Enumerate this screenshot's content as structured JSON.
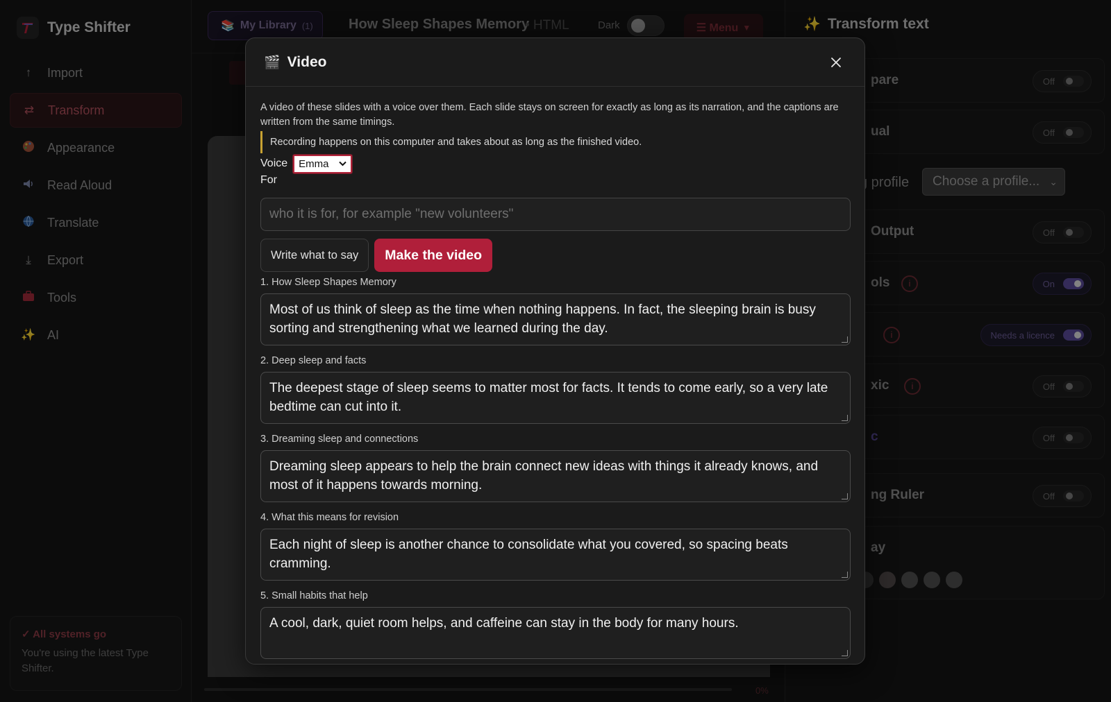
{
  "app": {
    "name": "Type Shifter"
  },
  "sidebar": {
    "items": [
      {
        "label": "Import",
        "icon": "arrow-up-icon"
      },
      {
        "label": "Transform",
        "icon": "swap-icon"
      },
      {
        "label": "Appearance",
        "icon": "palette-icon"
      },
      {
        "label": "Read Aloud",
        "icon": "speaker-icon"
      },
      {
        "label": "Translate",
        "icon": "globe-icon"
      },
      {
        "label": "Export",
        "icon": "download-icon"
      },
      {
        "label": "Tools",
        "icon": "toolbox-icon"
      },
      {
        "label": "AI",
        "icon": "sparkle-icon"
      }
    ],
    "active": "Transform",
    "status": {
      "title": "✓ All systems go",
      "text": "You're using the latest Type Shifter."
    }
  },
  "topbar": {
    "library_label": "My Library",
    "library_count": "(1)",
    "doc_title": "How Sleep Shapes Memory",
    "doc_format": "• HTML",
    "dark_label": "Dark",
    "menu_label": "☰ Menu"
  },
  "center": {
    "progress_text": "0%"
  },
  "right_panel": {
    "title": "Transform text",
    "rows": [
      {
        "label": "pare",
        "toggle": "Off"
      },
      {
        "label": "ual",
        "toggle": "Off"
      },
      {
        "label": "Output",
        "toggle": "Off"
      },
      {
        "label": "ols",
        "toggle": "On"
      },
      {
        "label": "",
        "toggle": "Needs a licence"
      },
      {
        "label": "xic",
        "toggle": "Off"
      },
      {
        "label": "c",
        "toggle": "Off"
      },
      {
        "label": "ng Ruler",
        "toggle": "Off"
      },
      {
        "label": "ay",
        "toggle": ""
      }
    ],
    "profile_label": "g profile",
    "profile_select": "Choose a profile..."
  },
  "modal": {
    "title": "Video",
    "description": "A video of these slides with a voice over them. Each slide stays on screen for exactly as long as its narration, and the captions are written from the same timings.",
    "note": "Recording happens on this computer and takes about as long as the finished video.",
    "voice_label": "Voice",
    "voice_value": "Emma",
    "for_label": "For",
    "for_placeholder": "who it is for, for example \"new volunteers\"",
    "write_button": "Write what to say",
    "make_button": "Make the video",
    "slides": [
      {
        "label": "1. How Sleep Shapes Memory",
        "text": "Most of us think of sleep as the time when nothing happens. In fact, the sleeping brain is busy sorting and strengthening what we learned during the day."
      },
      {
        "label": "2. Deep sleep and facts",
        "text": "The deepest stage of sleep seems to matter most for facts. It tends to come early, so a very late bedtime can cut into it."
      },
      {
        "label": "3. Dreaming sleep and connections",
        "text": "Dreaming sleep appears to help the brain connect new ideas with things it already knows, and most of it happens towards morning."
      },
      {
        "label": "4. What this means for revision",
        "text": "Each night of sleep is another chance to consolidate what you covered, so spacing beats cramming."
      },
      {
        "label": "5. Small habits that help",
        "text": "A cool, dark, quiet room helps, and caffeine can stay in the body for many hours."
      }
    ]
  },
  "colors": {
    "accent": "#b01f3a",
    "note_bar": "#c8a232",
    "toggle_on": "#5a4a9a"
  }
}
